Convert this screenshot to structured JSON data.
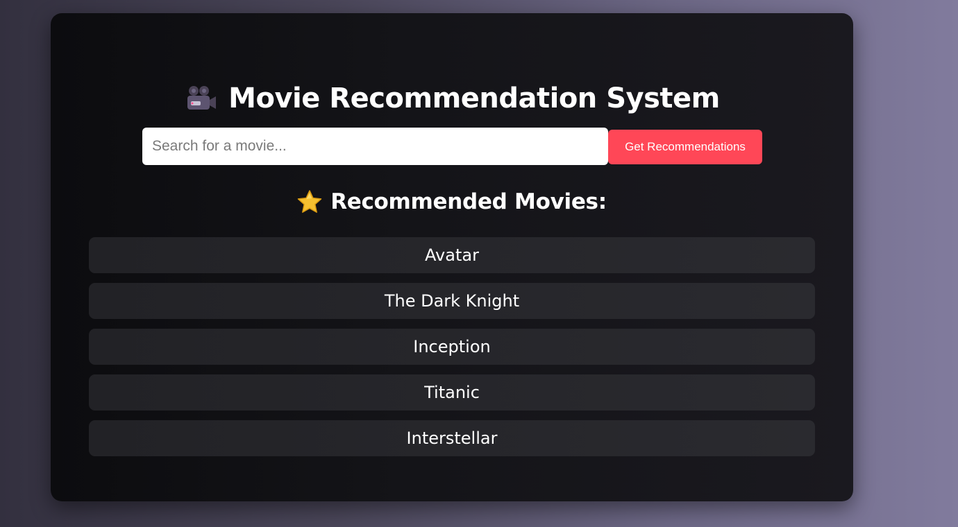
{
  "header": {
    "title": "Movie Recommendation System",
    "icon": "movie-camera-icon"
  },
  "search": {
    "placeholder": "Search for a movie...",
    "value": "",
    "button_label": "Get Recommendations"
  },
  "results": {
    "heading": "Recommended Movies:",
    "icon": "star-icon",
    "movies": [
      "Avatar",
      "The Dark Knight",
      "Inception",
      "Titanic",
      "Interstellar"
    ]
  },
  "colors": {
    "accent": "#ff4757",
    "card_background": "#141418",
    "list_item_background": "#26262a"
  }
}
